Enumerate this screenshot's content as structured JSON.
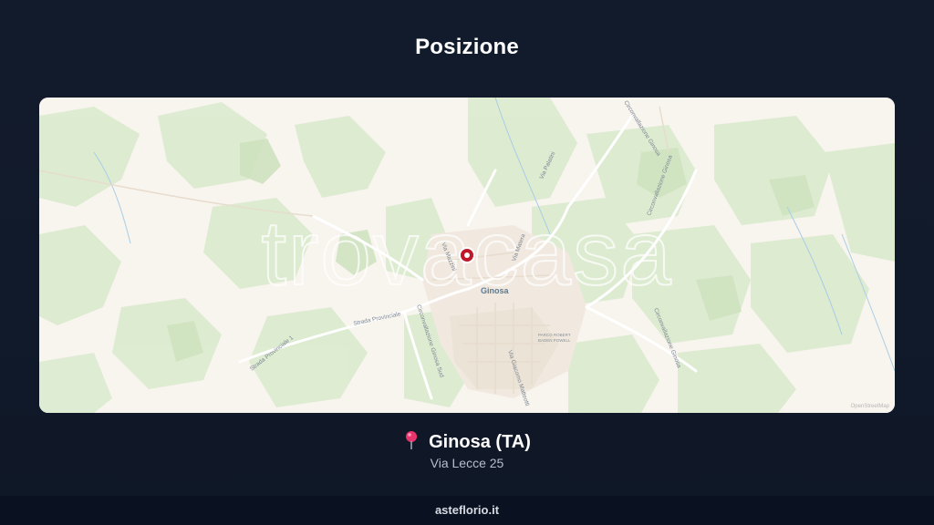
{
  "header": {
    "title": "Posizione"
  },
  "map": {
    "watermark": "trovacasa",
    "town_label": "Ginosa",
    "park_label_line1": "PARCO ROBERT",
    "park_label_line2": "BADEN POWELL",
    "road_labels": {
      "strada_provinciale_a": "Strada Provinciale",
      "strada_provinciale_b": "Strada Provinciale 1",
      "circ_sud": "Circonvallazione Ginosa Sud",
      "circ_ginosa_left": "Circonvallazione Ginosa",
      "circ_ginosa_right": "Circonvallazione Ginosa",
      "circ_ginosa_top": "Circonvallazione Ginosa",
      "via_mazzini": "Via Mazzini",
      "via_matera": "Via Matera",
      "via_palatini": "Via Palatini",
      "via_g_matteotti": "Via Giacomo Matteotti"
    },
    "attribution": "OpenStreetMap",
    "marker_icon": "map-marker-icon"
  },
  "location": {
    "pin_icon": "round-pushpin-icon",
    "city": "Ginosa (TA)",
    "address": "Via Lecce 25"
  },
  "footer": {
    "site": "asteflorio.it"
  }
}
